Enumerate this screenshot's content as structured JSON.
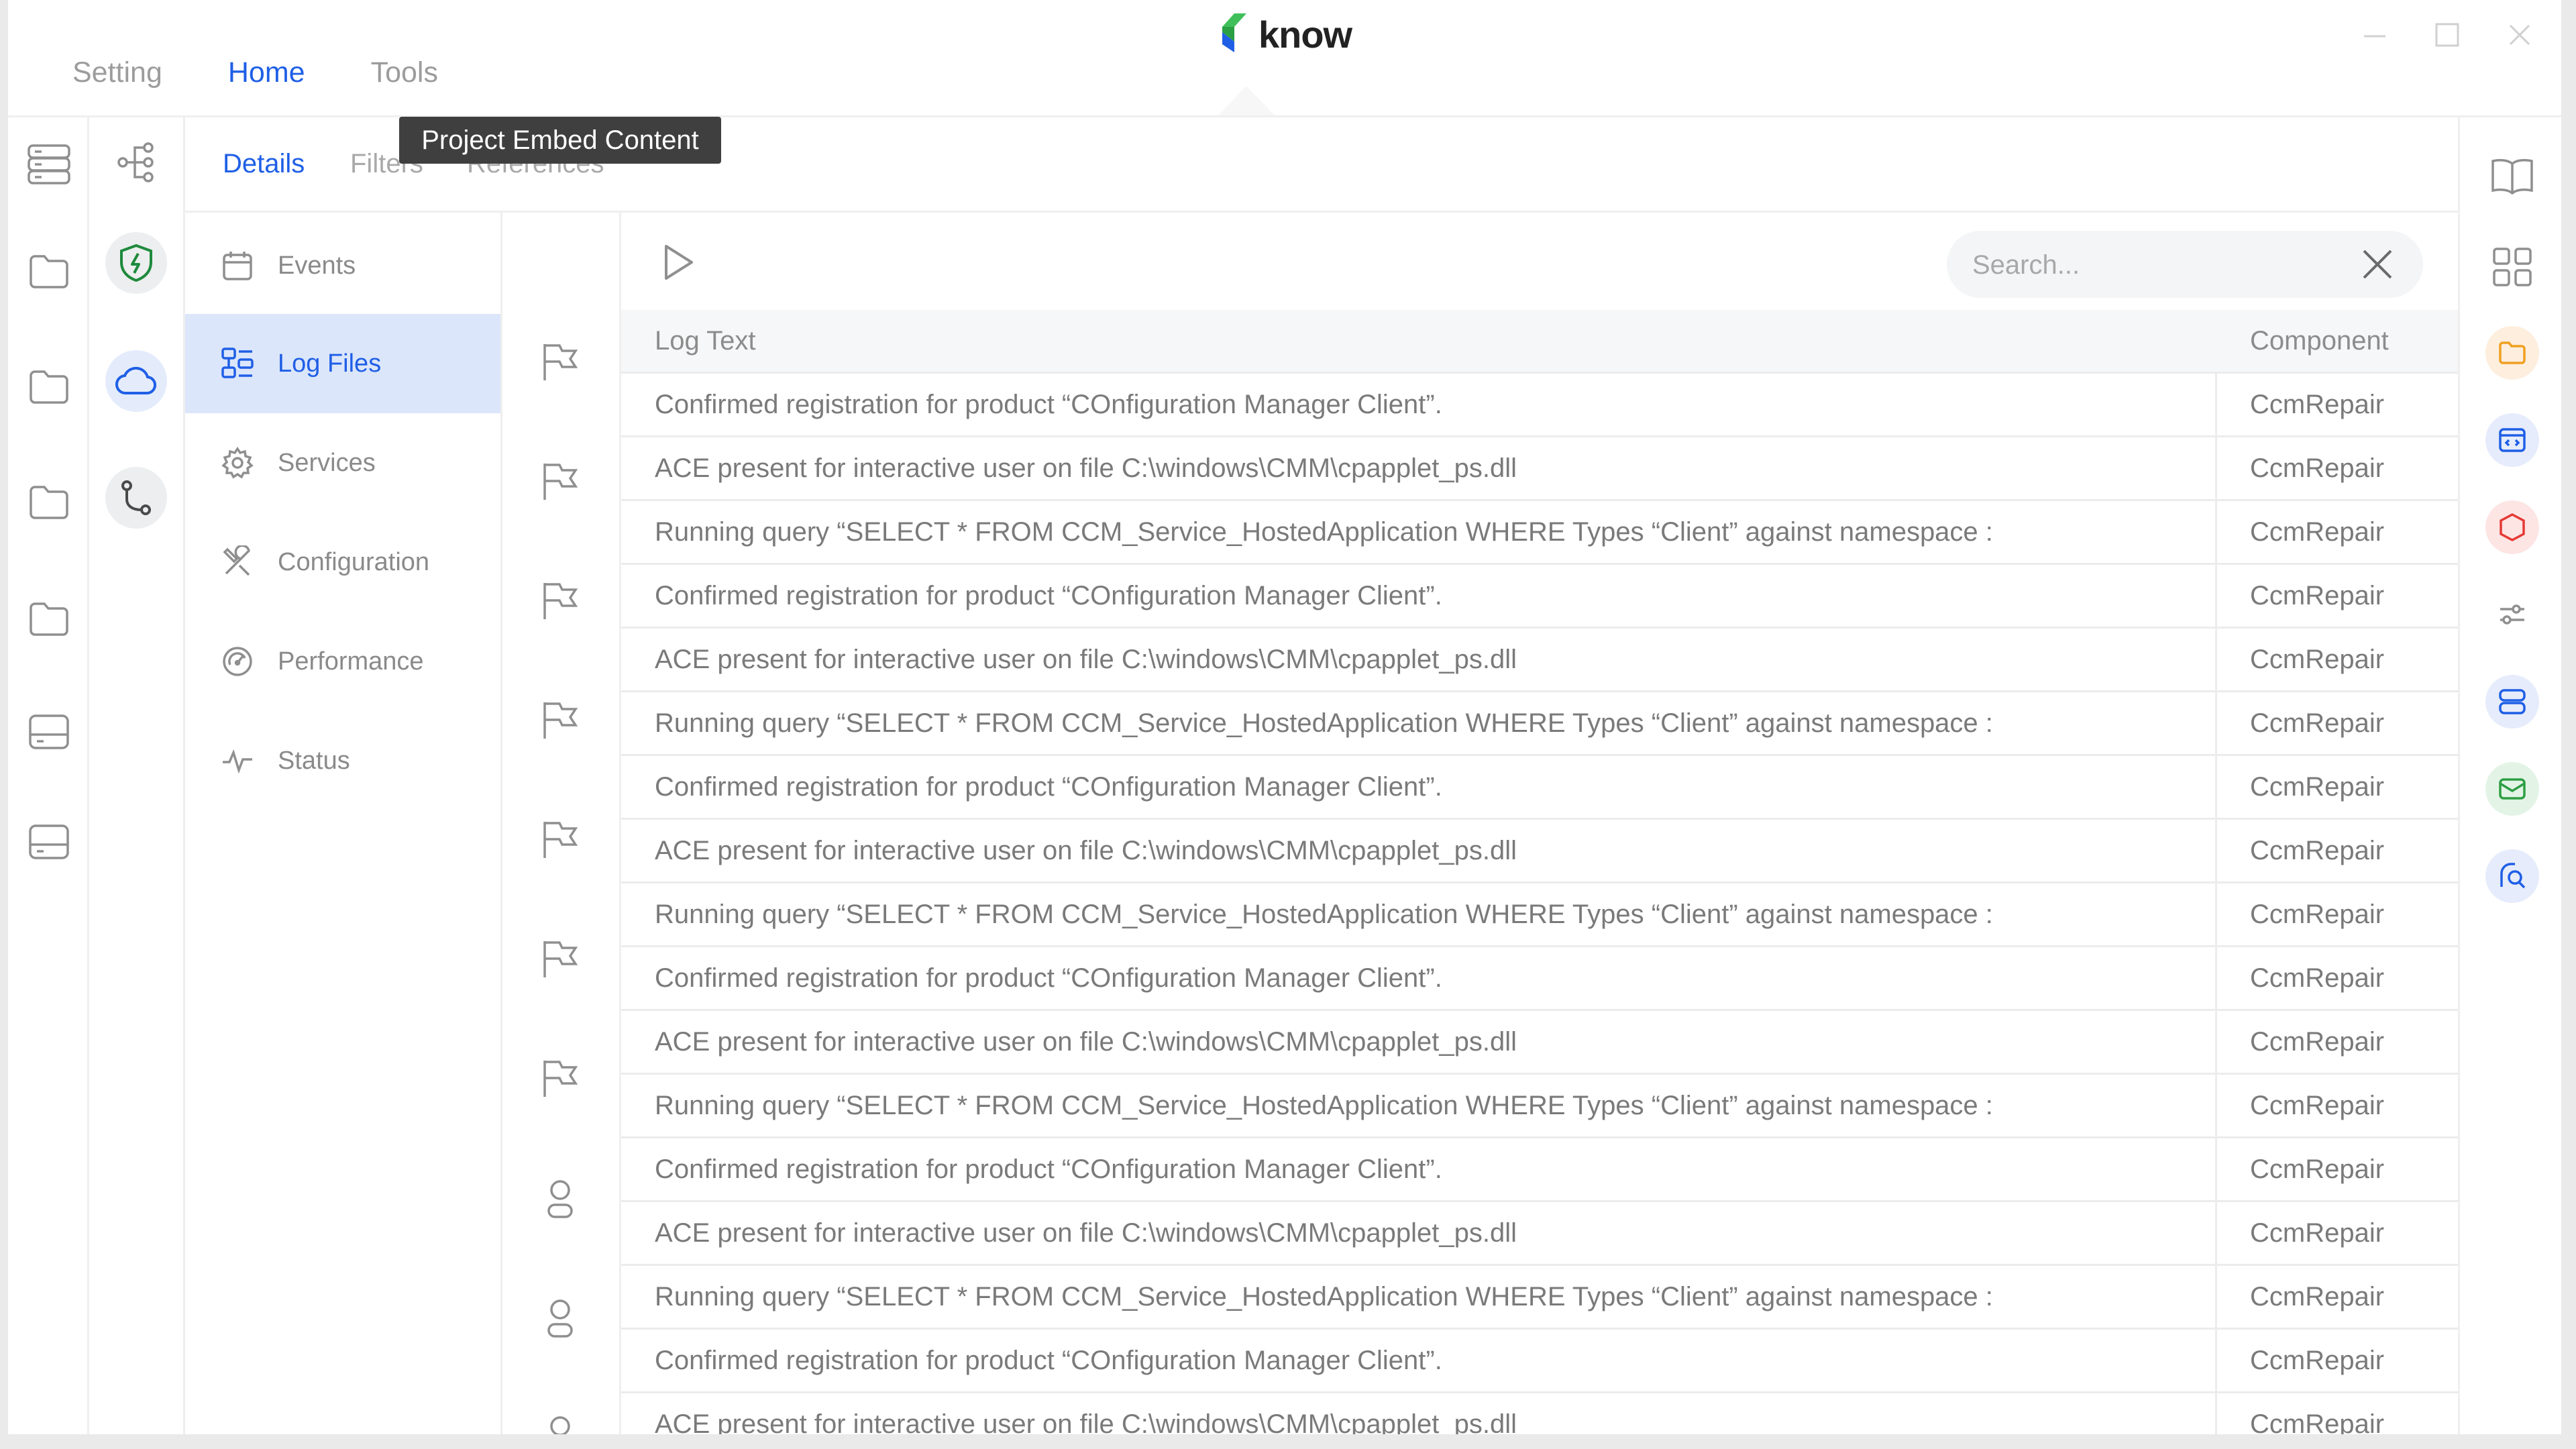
{
  "app": {
    "logo_text": "know",
    "top_nav": [
      {
        "label": "Setting",
        "active": false
      },
      {
        "label": "Home",
        "active": true
      },
      {
        "label": "Tools",
        "active": false
      }
    ],
    "tooltip": "Project Embed Content"
  },
  "subtabs": [
    {
      "label": "Details",
      "active": true
    },
    {
      "label": "Filters",
      "active": false
    },
    {
      "label": "References",
      "active": false
    }
  ],
  "menu": [
    {
      "label": "Events",
      "icon": "calendar-icon",
      "active": false
    },
    {
      "label": "Log Files",
      "icon": "log-files-icon",
      "active": true
    },
    {
      "label": "Services",
      "icon": "gear-icon",
      "active": false
    },
    {
      "label": "Configuration",
      "icon": "tools-icon",
      "active": false
    },
    {
      "label": "Performance",
      "icon": "gauge-icon",
      "active": false
    },
    {
      "label": "Status",
      "icon": "pulse-icon",
      "active": false
    }
  ],
  "search": {
    "placeholder": "Search..."
  },
  "table": {
    "columns": [
      "Log Text",
      "Component"
    ],
    "rows": [
      [
        "Confirmed registration for product “COnfiguration Manager Client”.",
        "CcmRepair"
      ],
      [
        "ACE present for interactive user on file C:\\windows\\CMM\\cpapplet_ps.dll",
        "CcmRepair"
      ],
      [
        "Running query “SELECT * FROM CCM_Service_HostedApplication WHERE Types “Client” against namespace :",
        "CcmRepair"
      ],
      [
        "Confirmed registration for product “COnfiguration Manager Client”.",
        "CcmRepair"
      ],
      [
        "ACE present for interactive user on file C:\\windows\\CMM\\cpapplet_ps.dll",
        "CcmRepair"
      ],
      [
        "Running query “SELECT * FROM CCM_Service_HostedApplication WHERE Types “Client” against namespace :",
        "CcmRepair"
      ],
      [
        "Confirmed registration for product “COnfiguration Manager Client”.",
        "CcmRepair"
      ],
      [
        "ACE present for interactive user on file C:\\windows\\CMM\\cpapplet_ps.dll",
        "CcmRepair"
      ],
      [
        "Running query “SELECT * FROM CCM_Service_HostedApplication WHERE Types “Client” against namespace :",
        "CcmRepair"
      ],
      [
        "Confirmed registration for product “COnfiguration Manager Client”.",
        "CcmRepair"
      ],
      [
        "ACE present for interactive user on file C:\\windows\\CMM\\cpapplet_ps.dll",
        "CcmRepair"
      ],
      [
        "Running query “SELECT * FROM CCM_Service_HostedApplication WHERE Types “Client” against namespace :",
        "CcmRepair"
      ],
      [
        "Confirmed registration for product “COnfiguration Manager Client”.",
        "CcmRepair"
      ],
      [
        "ACE present for interactive user on file C:\\windows\\CMM\\cpapplet_ps.dll",
        "CcmRepair"
      ],
      [
        "Running query “SELECT * FROM CCM_Service_HostedApplication WHERE Types “Client” against namespace :",
        "CcmRepair"
      ],
      [
        "Confirmed registration for product “COnfiguration Manager Client”.",
        "CcmRepair"
      ],
      [
        "ACE present for interactive user on file C:\\windows\\CMM\\cpapplet_ps.dll",
        "CcmRepair"
      ]
    ]
  },
  "colors": {
    "accent": "#1f5fe6",
    "active_menu_bg": "#dbe6fb",
    "shield_green": "#1e8a3c",
    "orange": "#f0a020",
    "red": "#e53935",
    "email_green": "#2e9e44"
  }
}
